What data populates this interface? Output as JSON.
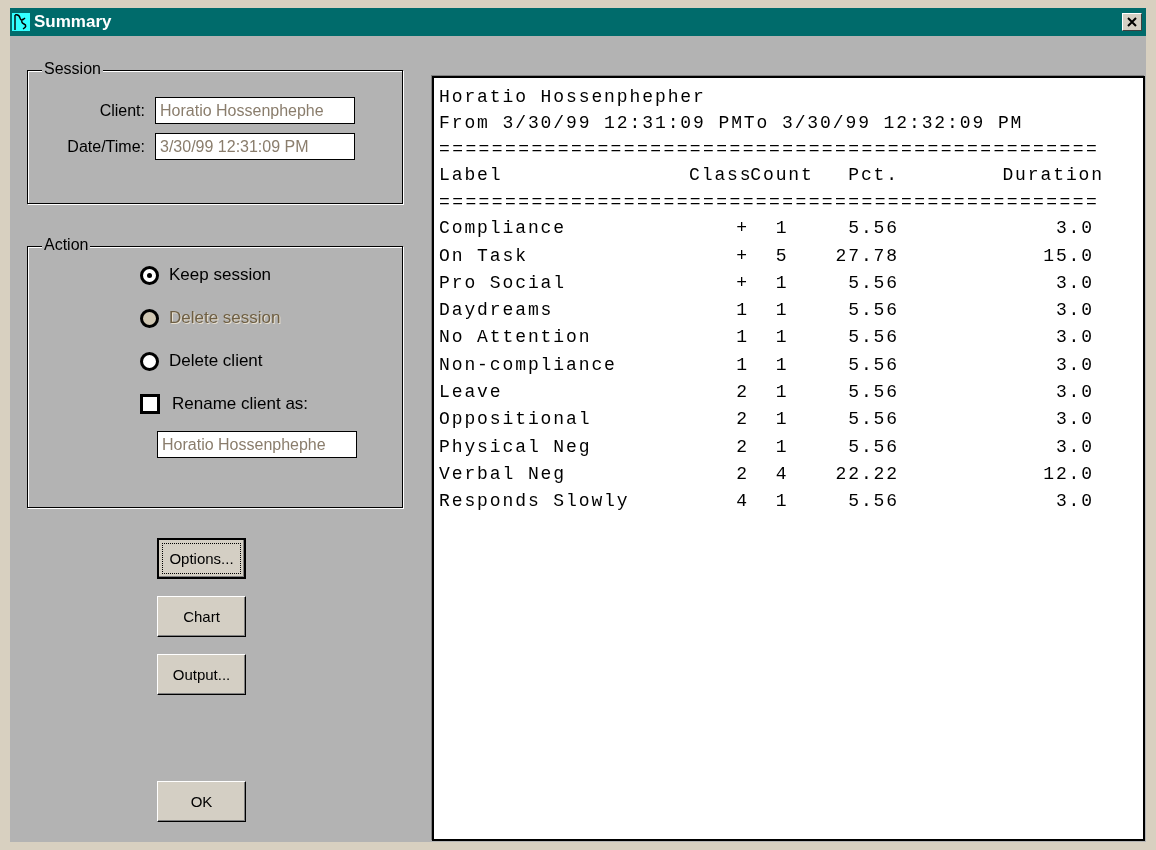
{
  "window": {
    "title": "Summary"
  },
  "session": {
    "title": "Session",
    "fields": [
      {
        "label": "Client:",
        "value": "Horatio Hossenphephe"
      },
      {
        "label": "Date/Time:",
        "value": "3/30/99 12:31:09 PM"
      }
    ]
  },
  "action": {
    "title": "Action",
    "options": [
      {
        "kind": "radio",
        "label": "Keep session",
        "selected": true,
        "disabled": false
      },
      {
        "kind": "radio",
        "label": "Delete session",
        "selected": false,
        "disabled": true
      },
      {
        "kind": "radio",
        "label": "Delete client",
        "selected": false,
        "disabled": false
      },
      {
        "kind": "checkbox",
        "label": "Rename client as:",
        "checked": false,
        "disabled": false
      }
    ],
    "rename_value": "Horatio Hossenphephe"
  },
  "buttons": [
    {
      "label": "Options...",
      "default": true
    },
    {
      "label": "Chart",
      "default": false
    },
    {
      "label": "Output...",
      "default": false
    }
  ],
  "ok_button": "OK",
  "report": {
    "title": "Horatio Hossenphepher",
    "range": "From 3/30/99 12:31:09 PMTo 3/30/99 12:32:09 PM",
    "rules": [
      "==================================================",
      "=================================================="
    ],
    "columns": [
      "Label",
      "Class",
      "Count",
      "Pct.",
      "Duration"
    ],
    "rows": [
      [
        "Compliance",
        "+",
        "1",
        "5.56",
        "3.0"
      ],
      [
        "On Task",
        "+",
        "5",
        "27.78",
        "15.0"
      ],
      [
        "Pro Social",
        "+",
        "1",
        "5.56",
        "3.0"
      ],
      [
        "Daydreams",
        "1",
        "1",
        "5.56",
        "3.0"
      ],
      [
        "No Attention",
        "1",
        "1",
        "5.56",
        "3.0"
      ],
      [
        "Non-compliance",
        "1",
        "1",
        "5.56",
        "3.0"
      ],
      [
        "Leave",
        "2",
        "1",
        "5.56",
        "3.0"
      ],
      [
        "Oppositional",
        "2",
        "1",
        "5.56",
        "3.0"
      ],
      [
        "Physical Neg",
        "2",
        "1",
        "5.56",
        "3.0"
      ],
      [
        "Verbal Neg",
        "2",
        "4",
        "22.22",
        "12.0"
      ],
      [
        "Responds Slowly",
        "4",
        "1",
        "5.56",
        "3.0"
      ]
    ]
  }
}
